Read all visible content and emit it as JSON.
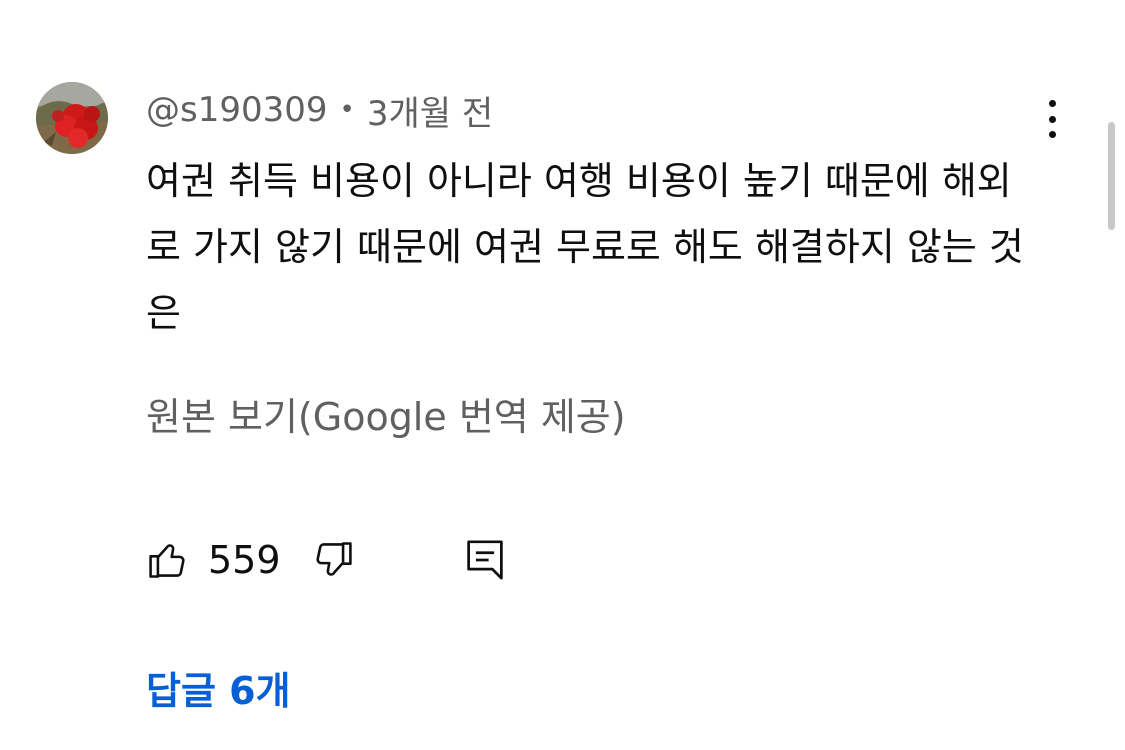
{
  "comment": {
    "author": "@s190309",
    "separator": "•",
    "time": "3개월 전",
    "text": "여권 취득 비용이 아니라 여행 비용이 높기 때문에 해외로 가지 않기 때문에 여권 무료로 해도 해결하지 않는 것은",
    "translation_link": "원본 보기(Google 번역 제공)",
    "like_count": "559",
    "replies_label": "답글 6개"
  },
  "icons": {
    "avatar": "avatar-autumn-leaves",
    "more": "more-vertical-icon",
    "like": "thumbs-up-icon",
    "dislike": "thumbs-down-icon",
    "reply": "comment-reply-icon"
  },
  "colors": {
    "text_primary": "#0f0f0f",
    "text_secondary": "#606060",
    "link": "#065fd4"
  }
}
